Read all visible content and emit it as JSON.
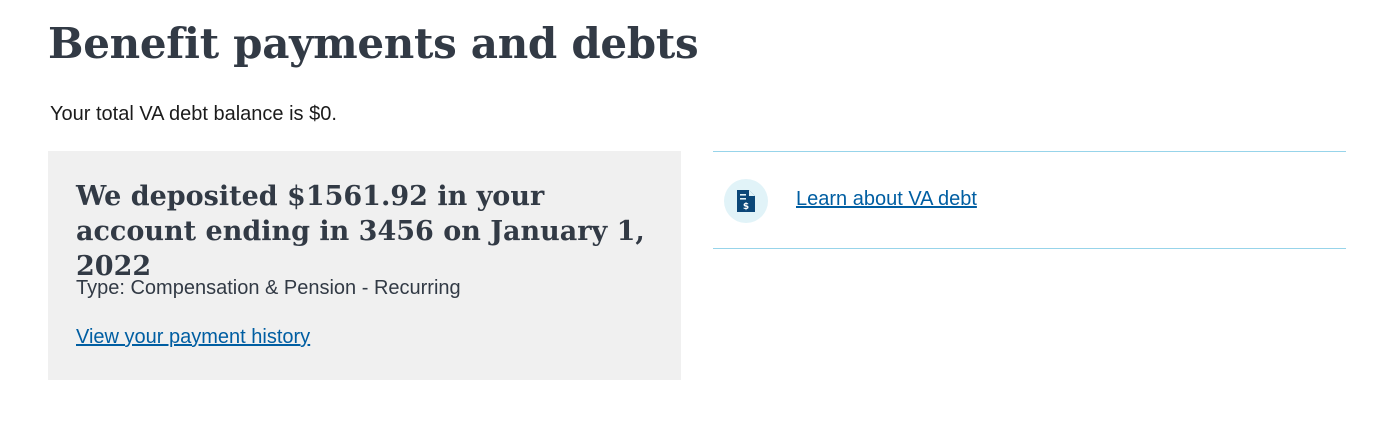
{
  "page": {
    "title": "Benefit payments and debts",
    "debt_balance_text": "Your total VA debt balance is $0."
  },
  "payment_card": {
    "heading": "We deposited $1561.92 in your account ending in 3456 on January 1, 2022",
    "type_text": "Type: Compensation & Pension - Recurring",
    "history_link_label": "View your payment history"
  },
  "resources": {
    "learn_debt_label": "Learn about VA debt",
    "learn_debt_icon": "file-dollar-icon"
  },
  "colors": {
    "heading": "#323a45",
    "link": "#005ea2",
    "card_background": "#f0f0f0",
    "divider": "#97d4ea",
    "icon_background": "#e1f3f8",
    "icon_foreground": "#0b4778"
  }
}
